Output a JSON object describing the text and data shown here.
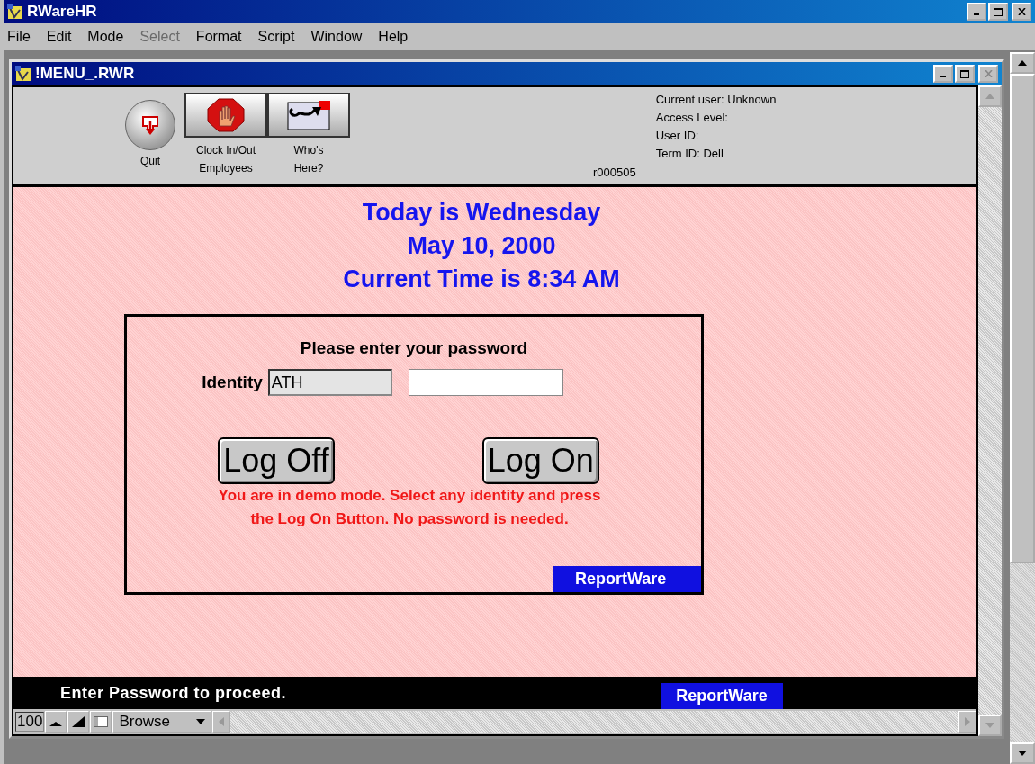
{
  "window": {
    "title": "RWareHR"
  },
  "menu": [
    {
      "label": "File",
      "disabled": false
    },
    {
      "label": "Edit",
      "disabled": false
    },
    {
      "label": "Mode",
      "disabled": false
    },
    {
      "label": "Select",
      "disabled": true
    },
    {
      "label": "Format",
      "disabled": false
    },
    {
      "label": "Script",
      "disabled": false
    },
    {
      "label": "Window",
      "disabled": false
    },
    {
      "label": "Help",
      "disabled": false
    }
  ],
  "document": {
    "title": "!MENU_.RWR",
    "toolbar": [
      {
        "kind": "round",
        "label": "Quit"
      },
      {
        "kind": "stop",
        "label": "Clock In/Out Employees"
      },
      {
        "kind": "arrow",
        "label": "Who's Here?"
      }
    ],
    "version": "r000505",
    "user_info": [
      "Current user: Unknown",
      "Access Level:",
      "User ID:",
      "Term ID: Dell"
    ],
    "heading": [
      "Today is Wednesday",
      "May 10, 2000",
      "Current Time is 8:34 AM"
    ],
    "login": {
      "prompt": "Please enter your password",
      "identity_label": "Identity",
      "identity_value": "ATH",
      "buttons": [
        "Log Off",
        "Log On"
      ],
      "note": "You are in demo mode.  Select any identity and press the Log On Button.  No password is needed.",
      "brand": "ReportWare"
    },
    "status_bar": {
      "message": "Enter Password to proceed.",
      "brand": "ReportWare"
    },
    "bottom_bar": {
      "zoom": "100",
      "mode": "Browse"
    }
  }
}
